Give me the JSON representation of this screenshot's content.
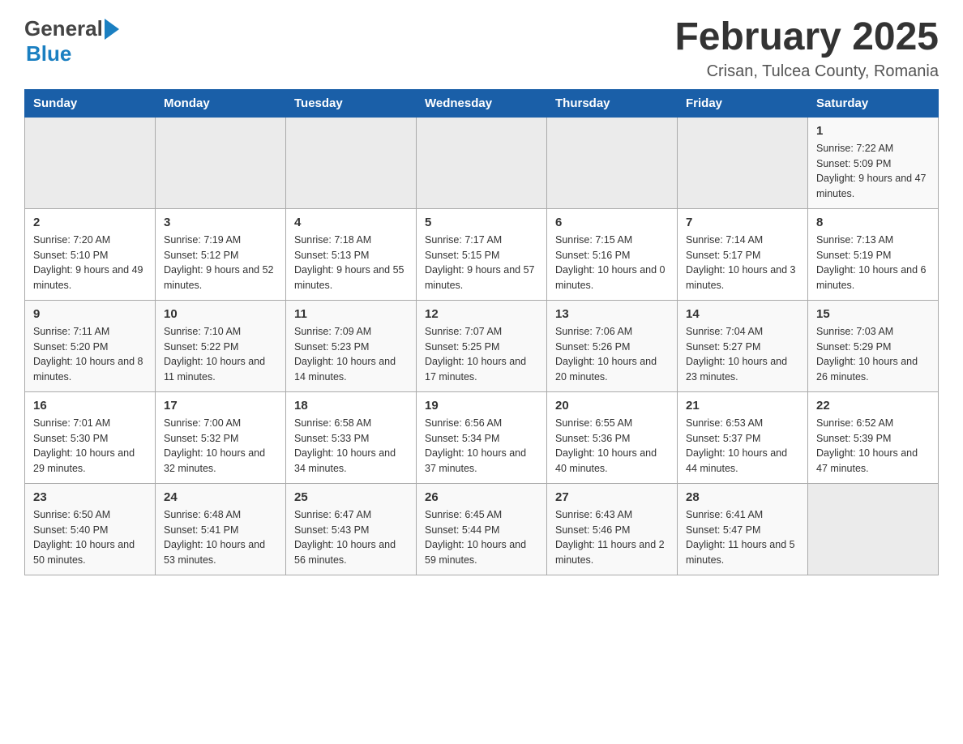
{
  "logo": {
    "general": "General",
    "blue": "Blue"
  },
  "header": {
    "title": "February 2025",
    "subtitle": "Crisan, Tulcea County, Romania"
  },
  "weekdays": [
    "Sunday",
    "Monday",
    "Tuesday",
    "Wednesday",
    "Thursday",
    "Friday",
    "Saturday"
  ],
  "weeks": [
    [
      {
        "day": "",
        "sunrise": "",
        "sunset": "",
        "daylight": ""
      },
      {
        "day": "",
        "sunrise": "",
        "sunset": "",
        "daylight": ""
      },
      {
        "day": "",
        "sunrise": "",
        "sunset": "",
        "daylight": ""
      },
      {
        "day": "",
        "sunrise": "",
        "sunset": "",
        "daylight": ""
      },
      {
        "day": "",
        "sunrise": "",
        "sunset": "",
        "daylight": ""
      },
      {
        "day": "",
        "sunrise": "",
        "sunset": "",
        "daylight": ""
      },
      {
        "day": "1",
        "sunrise": "Sunrise: 7:22 AM",
        "sunset": "Sunset: 5:09 PM",
        "daylight": "Daylight: 9 hours and 47 minutes."
      }
    ],
    [
      {
        "day": "2",
        "sunrise": "Sunrise: 7:20 AM",
        "sunset": "Sunset: 5:10 PM",
        "daylight": "Daylight: 9 hours and 49 minutes."
      },
      {
        "day": "3",
        "sunrise": "Sunrise: 7:19 AM",
        "sunset": "Sunset: 5:12 PM",
        "daylight": "Daylight: 9 hours and 52 minutes."
      },
      {
        "day": "4",
        "sunrise": "Sunrise: 7:18 AM",
        "sunset": "Sunset: 5:13 PM",
        "daylight": "Daylight: 9 hours and 55 minutes."
      },
      {
        "day": "5",
        "sunrise": "Sunrise: 7:17 AM",
        "sunset": "Sunset: 5:15 PM",
        "daylight": "Daylight: 9 hours and 57 minutes."
      },
      {
        "day": "6",
        "sunrise": "Sunrise: 7:15 AM",
        "sunset": "Sunset: 5:16 PM",
        "daylight": "Daylight: 10 hours and 0 minutes."
      },
      {
        "day": "7",
        "sunrise": "Sunrise: 7:14 AM",
        "sunset": "Sunset: 5:17 PM",
        "daylight": "Daylight: 10 hours and 3 minutes."
      },
      {
        "day": "8",
        "sunrise": "Sunrise: 7:13 AM",
        "sunset": "Sunset: 5:19 PM",
        "daylight": "Daylight: 10 hours and 6 minutes."
      }
    ],
    [
      {
        "day": "9",
        "sunrise": "Sunrise: 7:11 AM",
        "sunset": "Sunset: 5:20 PM",
        "daylight": "Daylight: 10 hours and 8 minutes."
      },
      {
        "day": "10",
        "sunrise": "Sunrise: 7:10 AM",
        "sunset": "Sunset: 5:22 PM",
        "daylight": "Daylight: 10 hours and 11 minutes."
      },
      {
        "day": "11",
        "sunrise": "Sunrise: 7:09 AM",
        "sunset": "Sunset: 5:23 PM",
        "daylight": "Daylight: 10 hours and 14 minutes."
      },
      {
        "day": "12",
        "sunrise": "Sunrise: 7:07 AM",
        "sunset": "Sunset: 5:25 PM",
        "daylight": "Daylight: 10 hours and 17 minutes."
      },
      {
        "day": "13",
        "sunrise": "Sunrise: 7:06 AM",
        "sunset": "Sunset: 5:26 PM",
        "daylight": "Daylight: 10 hours and 20 minutes."
      },
      {
        "day": "14",
        "sunrise": "Sunrise: 7:04 AM",
        "sunset": "Sunset: 5:27 PM",
        "daylight": "Daylight: 10 hours and 23 minutes."
      },
      {
        "day": "15",
        "sunrise": "Sunrise: 7:03 AM",
        "sunset": "Sunset: 5:29 PM",
        "daylight": "Daylight: 10 hours and 26 minutes."
      }
    ],
    [
      {
        "day": "16",
        "sunrise": "Sunrise: 7:01 AM",
        "sunset": "Sunset: 5:30 PM",
        "daylight": "Daylight: 10 hours and 29 minutes."
      },
      {
        "day": "17",
        "sunrise": "Sunrise: 7:00 AM",
        "sunset": "Sunset: 5:32 PM",
        "daylight": "Daylight: 10 hours and 32 minutes."
      },
      {
        "day": "18",
        "sunrise": "Sunrise: 6:58 AM",
        "sunset": "Sunset: 5:33 PM",
        "daylight": "Daylight: 10 hours and 34 minutes."
      },
      {
        "day": "19",
        "sunrise": "Sunrise: 6:56 AM",
        "sunset": "Sunset: 5:34 PM",
        "daylight": "Daylight: 10 hours and 37 minutes."
      },
      {
        "day": "20",
        "sunrise": "Sunrise: 6:55 AM",
        "sunset": "Sunset: 5:36 PM",
        "daylight": "Daylight: 10 hours and 40 minutes."
      },
      {
        "day": "21",
        "sunrise": "Sunrise: 6:53 AM",
        "sunset": "Sunset: 5:37 PM",
        "daylight": "Daylight: 10 hours and 44 minutes."
      },
      {
        "day": "22",
        "sunrise": "Sunrise: 6:52 AM",
        "sunset": "Sunset: 5:39 PM",
        "daylight": "Daylight: 10 hours and 47 minutes."
      }
    ],
    [
      {
        "day": "23",
        "sunrise": "Sunrise: 6:50 AM",
        "sunset": "Sunset: 5:40 PM",
        "daylight": "Daylight: 10 hours and 50 minutes."
      },
      {
        "day": "24",
        "sunrise": "Sunrise: 6:48 AM",
        "sunset": "Sunset: 5:41 PM",
        "daylight": "Daylight: 10 hours and 53 minutes."
      },
      {
        "day": "25",
        "sunrise": "Sunrise: 6:47 AM",
        "sunset": "Sunset: 5:43 PM",
        "daylight": "Daylight: 10 hours and 56 minutes."
      },
      {
        "day": "26",
        "sunrise": "Sunrise: 6:45 AM",
        "sunset": "Sunset: 5:44 PM",
        "daylight": "Daylight: 10 hours and 59 minutes."
      },
      {
        "day": "27",
        "sunrise": "Sunrise: 6:43 AM",
        "sunset": "Sunset: 5:46 PM",
        "daylight": "Daylight: 11 hours and 2 minutes."
      },
      {
        "day": "28",
        "sunrise": "Sunrise: 6:41 AM",
        "sunset": "Sunset: 5:47 PM",
        "daylight": "Daylight: 11 hours and 5 minutes."
      },
      {
        "day": "",
        "sunrise": "",
        "sunset": "",
        "daylight": ""
      }
    ]
  ]
}
